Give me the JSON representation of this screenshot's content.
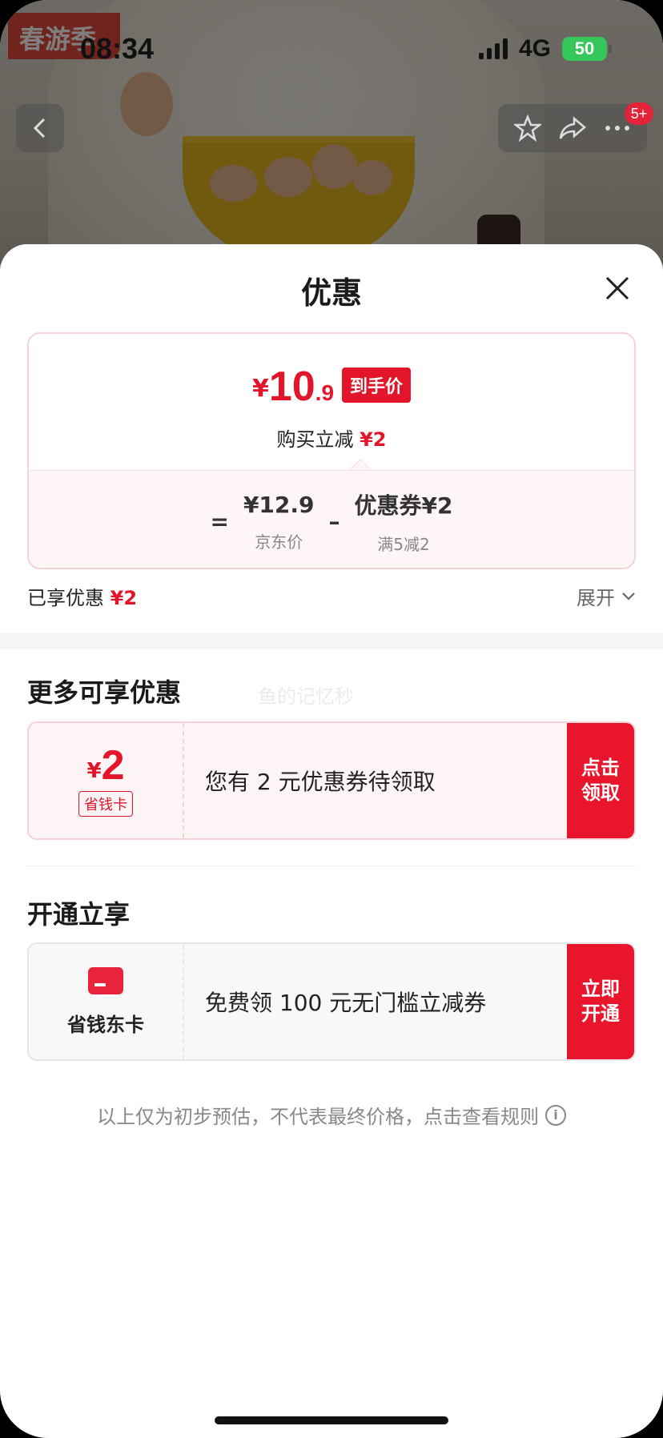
{
  "status_bar": {
    "time": "08:34",
    "network": "4G",
    "battery": "50"
  },
  "background": {
    "promo_tag": "春游季",
    "cart_badge": "5+"
  },
  "sheet": {
    "title": "优惠",
    "price_summary": {
      "currency": "¥",
      "final_int": "10",
      "final_dec": ".9",
      "final_tag": "到手价",
      "instant_label": "购买立减",
      "instant_value": "¥2",
      "equals": "=",
      "jd_price": "¥12.9",
      "jd_label": "京东价",
      "minus": "–",
      "coupon_text": "优惠券¥2",
      "coupon_rule": "满5减2"
    },
    "enjoyed_label": "已享优惠",
    "enjoyed_value": "¥2",
    "expand_label": "展开",
    "more_title": "更多可享优惠",
    "watermark": "鱼的记忆秒",
    "coupon_card": {
      "currency": "¥",
      "amount": "2",
      "tag": "省钱卡",
      "desc": "您有 2 元优惠券待领取",
      "button": "点击领取"
    },
    "open_title": "开通立享",
    "member_card": {
      "label": "省钱东卡",
      "desc": "免费领 100 元无门槛立减券",
      "button": "立即开通"
    },
    "disclaimer": "以上仅为初步预估，不代表最终价格，点击查看规则"
  },
  "colors": {
    "accent": "#e3152a",
    "border": "#f6d2d6"
  }
}
